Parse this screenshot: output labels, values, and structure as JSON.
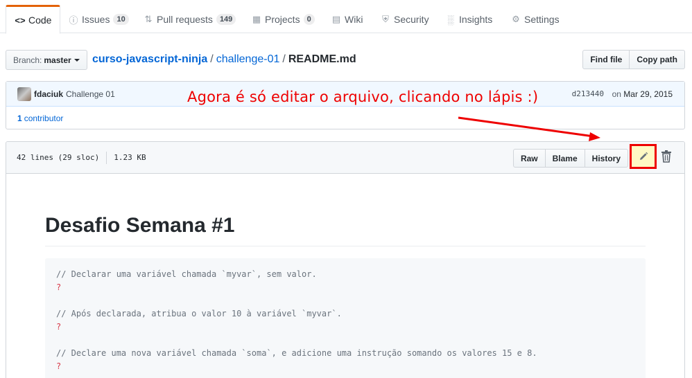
{
  "nav": {
    "tabs": [
      {
        "label": "Code",
        "icon": "code-icon"
      },
      {
        "label": "Issues",
        "icon": "issue-opened-icon",
        "count": "10"
      },
      {
        "label": "Pull requests",
        "icon": "git-pull-request-icon",
        "count": "149"
      },
      {
        "label": "Projects",
        "icon": "project-icon",
        "count": "0"
      },
      {
        "label": "Wiki",
        "icon": "book-icon"
      },
      {
        "label": "Security",
        "icon": "shield-icon"
      },
      {
        "label": "Insights",
        "icon": "graph-icon"
      },
      {
        "label": "Settings",
        "icon": "gear-icon"
      }
    ]
  },
  "branch": {
    "prefix": "Branch:",
    "name": "master"
  },
  "breadcrumb": {
    "repo": "curso-javascript-ninja",
    "folder": "challenge-01",
    "file": "README.md"
  },
  "header_buttons": {
    "find_file": "Find file",
    "copy_path": "Copy path"
  },
  "commit": {
    "author": "fdaciuk",
    "message": "Challenge 01",
    "sha": "d213440",
    "date_prefix": "on",
    "date": "Mar 29, 2015"
  },
  "contributors": {
    "count": "1",
    "label": "contributor"
  },
  "annotation": "Agora é só editar o arquivo, clicando no lápis :)",
  "annotation_color": "#ee0000",
  "file": {
    "lines": "42 lines (29 sloc)",
    "size": "1.23 KB",
    "actions": {
      "raw": "Raw",
      "blame": "Blame",
      "history": "History"
    }
  },
  "readme": {
    "title": "Desafio Semana #1",
    "code_lines": [
      {
        "comment": "// Declarar uma variável chamada `myvar`, sem valor.",
        "answer": "?"
      },
      {
        "comment": "// Após declarada, atribua o valor 10 à variável `myvar`.",
        "answer": "?"
      },
      {
        "comment": "// Declare uma nova variável chamada `soma`, e adicione uma instrução somando os valores 15 e 8.",
        "answer": "?"
      }
    ]
  }
}
